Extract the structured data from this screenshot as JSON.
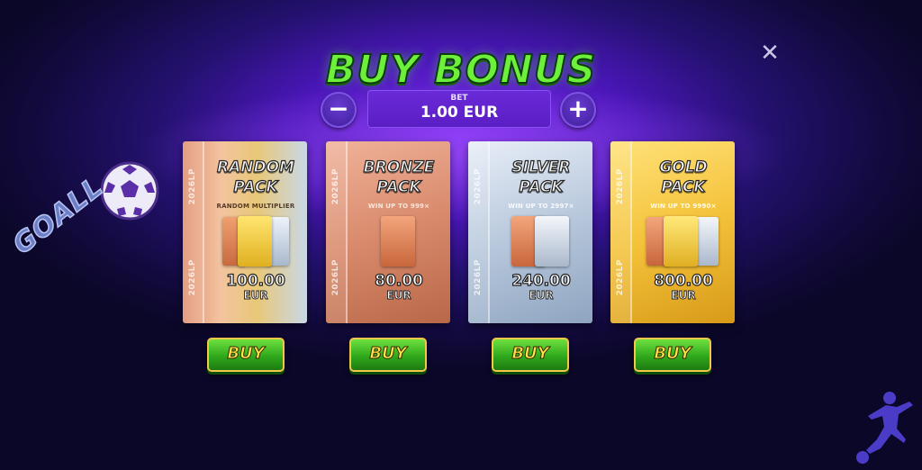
{
  "title": "BUY BONUS",
  "close_icon": "close-icon",
  "bet": {
    "label": "BET",
    "value": "1.00 EUR",
    "minus": "−",
    "plus": "+"
  },
  "packs": [
    {
      "name_line1": "RANDOM",
      "name_line2": "PACK",
      "desc": "RANDOM MULTIPLIER",
      "price": "100.00",
      "currency": "EUR",
      "side": "2026LP",
      "buy": "BUY"
    },
    {
      "name_line1": "BRONZE",
      "name_line2": "PACK",
      "desc": "WIN UP TO 999×",
      "price": "80.00",
      "currency": "EUR",
      "side": "2026LP",
      "buy": "BUY"
    },
    {
      "name_line1": "SILVER",
      "name_line2": "PACK",
      "desc": "WIN UP TO 2997×",
      "price": "240.00",
      "currency": "EUR",
      "side": "2026LP",
      "buy": "BUY"
    },
    {
      "name_line1": "GOLD",
      "name_line2": "PACK",
      "desc": "WIN UP TO 9990×",
      "price": "800.00",
      "currency": "EUR",
      "side": "2026LP",
      "buy": "BUY"
    }
  ],
  "logo": {
    "text": "GOALL"
  },
  "colors": {
    "title_green": "#6cf03a",
    "bet_purple": "#5a1ec4",
    "buy_green": "#2fa81c",
    "buy_text": "#ffe44a",
    "bronze": "#d98a6c",
    "silver": "#b8c8dc",
    "gold": "#f4c23a"
  }
}
